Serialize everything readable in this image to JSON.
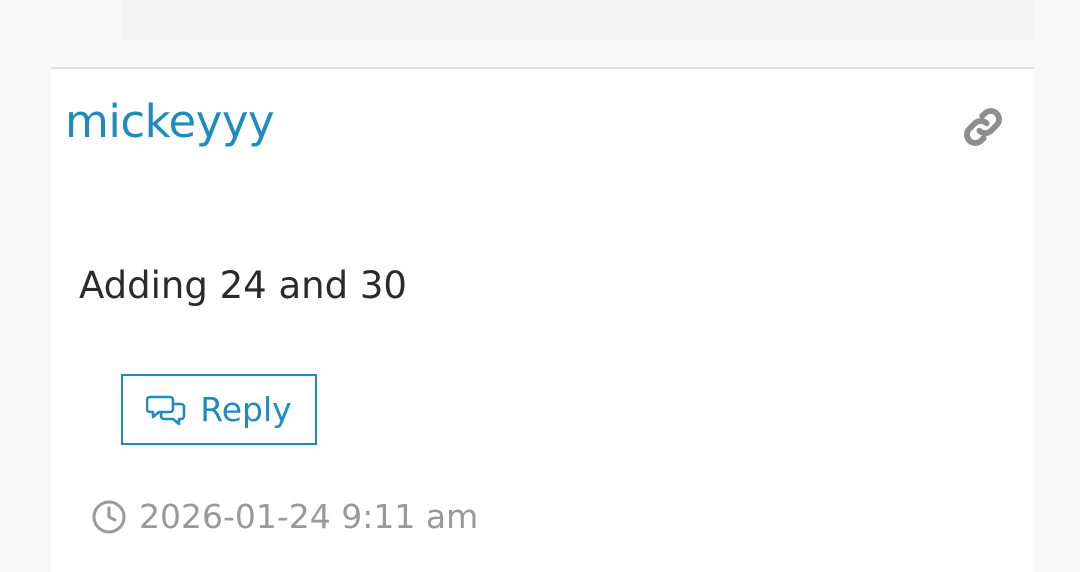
{
  "comment": {
    "author": "mickeyyy",
    "text": "Adding 24 and 30",
    "reply_label": "Reply",
    "timestamp": "2026-01-24 9:11 am"
  },
  "icons": {
    "permalink": "link-icon",
    "reply": "speech-bubbles-icon",
    "timestamp": "clock-icon"
  },
  "colors": {
    "accent": "#1e8cbe",
    "muted": "#999999",
    "text": "#2a2a2a"
  }
}
